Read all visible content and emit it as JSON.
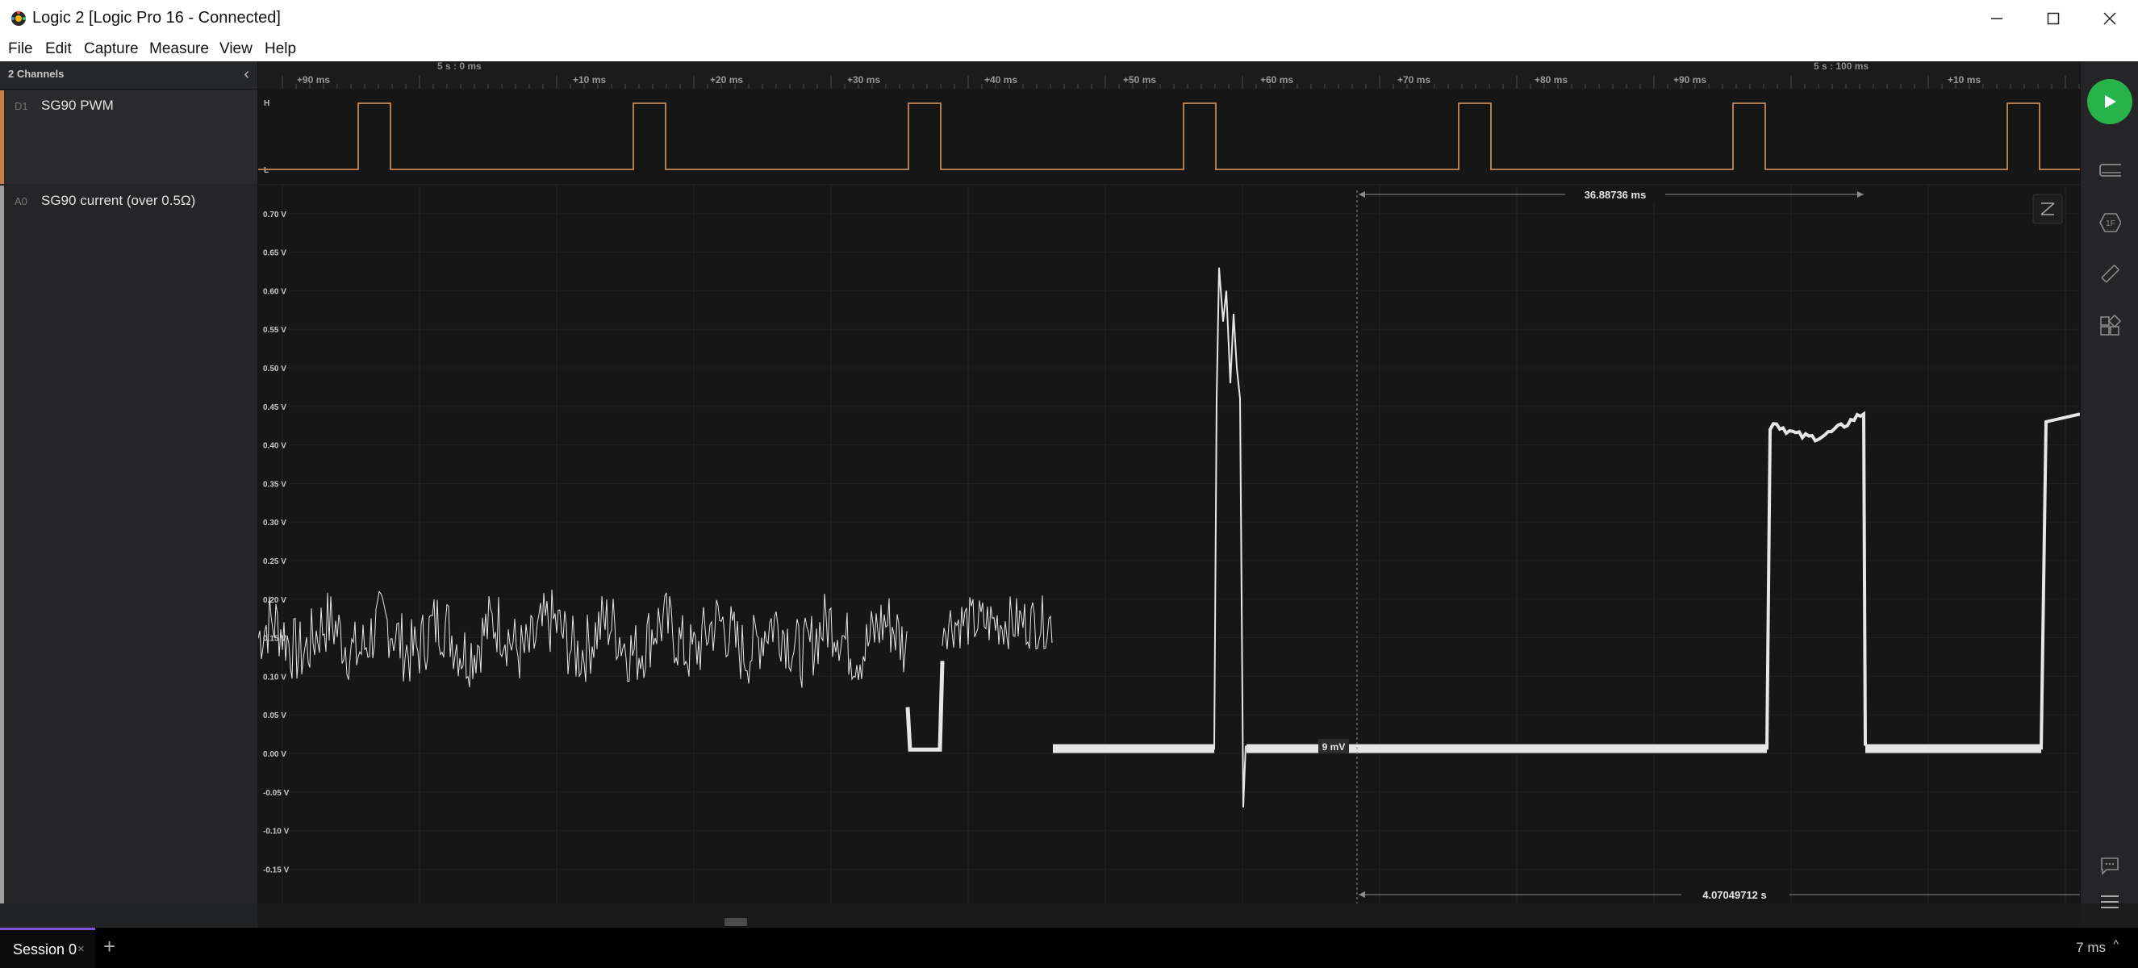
{
  "window": {
    "title": "Logic 2 [Logic Pro 16 - Connected]",
    "minimize_icon": "minimize-icon",
    "maximize_icon": "maximize-icon",
    "close_icon": "close-icon"
  },
  "menu": [
    "File",
    "Edit",
    "Capture",
    "Measure",
    "View",
    "Help"
  ],
  "sidebar": {
    "channels_count": "2 Channels",
    "channels": [
      {
        "index": "D1",
        "name": "SG90 PWM",
        "color": "#c77f46"
      },
      {
        "index": "A0",
        "name": "SG90 current (over 0.5Ω)",
        "color": "#9f9f9f"
      }
    ]
  },
  "timeline": {
    "major_labels": [
      "5 s : 0 ms",
      "5 s : 100 ms"
    ],
    "tick_labels": [
      "+90 ms",
      "+10 ms",
      "+20 ms",
      "+30 ms",
      "+40 ms",
      "+50 ms",
      "+60 ms",
      "+70 ms",
      "+80 ms",
      "+90 ms",
      "+10 ms"
    ]
  },
  "digital": {
    "high_label": "H",
    "low_label": "L"
  },
  "analog": {
    "y_labels": [
      "0.70 V",
      "0.65 V",
      "0.60 V",
      "0.55 V",
      "0.50 V",
      "0.45 V",
      "0.40 V",
      "0.35 V",
      "0.30 V",
      "0.25 V",
      "0.20 V",
      "0.15 V",
      "0.10 V",
      "0.05 V",
      "0.00 V",
      "-0.05 V",
      "-0.10 V",
      "-0.15 V"
    ],
    "cursor_value": "9 mV",
    "measurement_top": "36.88736 ms",
    "measurement_bottom": "4.07049712 s",
    "trace_color": "#e6e6e6"
  },
  "toolbar": {
    "play_icon": "play-icon",
    "tools": [
      "analyzers-icon",
      "timing-marker-icon",
      "measure-icon",
      "extensions-icon"
    ],
    "bottom_tools": [
      "feedback-icon",
      "menu-icon"
    ]
  },
  "session": {
    "tab_label": "Session 0",
    "close_glyph": "×",
    "add_glyph": "+",
    "zoom_label": "7 ms",
    "zoom_chevron": "^"
  }
}
